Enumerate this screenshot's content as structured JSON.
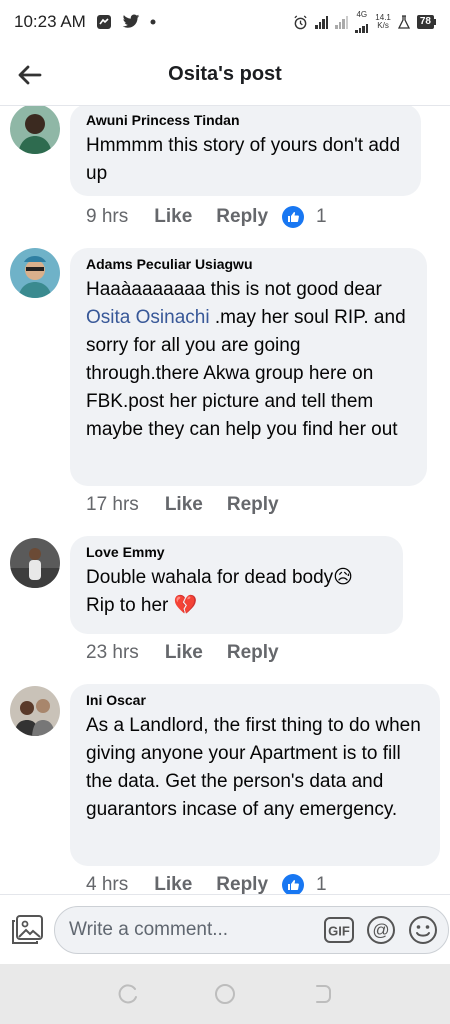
{
  "status_bar": {
    "time": "10:23 AM",
    "network_type": "4G",
    "net_speed_value": "14.1",
    "net_speed_unit": "K/s",
    "battery": "78"
  },
  "header": {
    "title": "Osita's post",
    "back_icon": "arrow-left-icon"
  },
  "comments": [
    {
      "author": "Awuni Princess Tindan",
      "text_parts": [
        "Hmmmm this story of yours don't add up"
      ],
      "time": "9 hrs",
      "like_label": "Like",
      "reply_label": "Reply",
      "reaction_count": "1"
    },
    {
      "author": "Adams Peculiar Usiagwu",
      "text_before": "Haaàaaaaaaa this is not good dear ",
      "mention": "Osita Osinachi",
      "text_after": " .may her soul RIP. and sorry for all you are going through.there Akwa group here on FBK.post her picture and tell them maybe they can help you find her out",
      "time": "17 hrs",
      "like_label": "Like",
      "reply_label": "Reply"
    },
    {
      "author": "Love Emmy",
      "line1": "Double wahala for dead body😥",
      "line2": "Rip to her 💔",
      "time": "23 hrs",
      "like_label": "Like",
      "reply_label": "Reply"
    },
    {
      "author": "Ini Oscar",
      "text": "As a Landlord, the first thing to do when giving anyone your Apartment is to fill the data. Get the person's data and guarantors incase of any emergency.",
      "time": "4 hrs",
      "like_label": "Like",
      "reply_label": "Reply",
      "reaction_count": "1"
    }
  ],
  "composer": {
    "placeholder": "Write a comment...",
    "gif_label": "GIF",
    "at_label": "@"
  },
  "colors": {
    "bubble": "#f0f2f5",
    "accent": "#1877f2",
    "mention": "#385898",
    "meta": "#65676b"
  }
}
